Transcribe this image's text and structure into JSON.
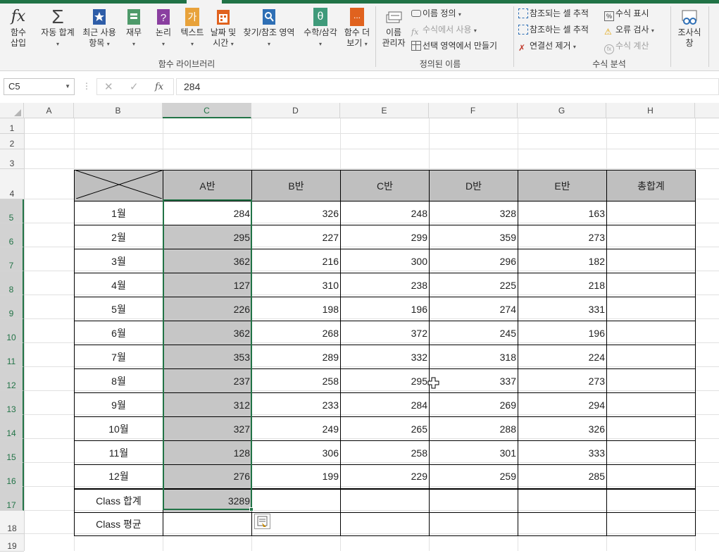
{
  "ribbon": {
    "groups": {
      "library": "함수 라이브러리",
      "names": "정의된 이름",
      "audit": "수식 분석"
    },
    "insert_fn": [
      "함수",
      "삽입"
    ],
    "autosum": [
      "자동 합계"
    ],
    "recent": [
      "최근 사용",
      "항목"
    ],
    "financial": [
      "재무"
    ],
    "logical": [
      "논리"
    ],
    "text": [
      "텍스트"
    ],
    "datetime": [
      "날짜 및",
      "시간"
    ],
    "lookup": [
      "찾기/참조 영역"
    ],
    "math": [
      "수학/삼각"
    ],
    "more": [
      "함수 더",
      "보기"
    ],
    "name_manager": [
      "이름",
      "관리자"
    ],
    "define_name": "이름 정의",
    "use_in_formula": "수식에서 사용",
    "create_from_sel": "선택 영역에서 만들기",
    "trace_precedents": "참조되는 셀 추적",
    "trace_dependents": "참조하는 셀 추적",
    "remove_arrows": "연결선 제거",
    "show_formulas": "수식 표시",
    "error_check": "오류 검사",
    "eval_formula": "수식 계산",
    "watch": [
      "조사식",
      "창"
    ],
    "text_icon": "가",
    "math_icon": "θ",
    "more_icon": "...",
    "fx_icon": "fx",
    "sigma_icon": "Σ"
  },
  "formula_bar": {
    "name_box": "C5",
    "value": "284"
  },
  "columns": [
    "A",
    "B",
    "C",
    "D",
    "E",
    "F",
    "G",
    "H"
  ],
  "rows": [
    "1",
    "2",
    "3",
    "4",
    "5",
    "6",
    "7",
    "8",
    "9",
    "10",
    "11",
    "12",
    "13",
    "14",
    "15",
    "16",
    "17",
    "18",
    "19"
  ],
  "table": {
    "headers": [
      "A반",
      "B반",
      "C반",
      "D반",
      "E반",
      "총합계"
    ],
    "months": [
      "1월",
      "2월",
      "3월",
      "4월",
      "5월",
      "6월",
      "7월",
      "8월",
      "9월",
      "10월",
      "11월",
      "12월"
    ],
    "values": [
      [
        284,
        326,
        248,
        328,
        163
      ],
      [
        295,
        227,
        299,
        359,
        273
      ],
      [
        362,
        216,
        300,
        296,
        182
      ],
      [
        127,
        310,
        238,
        225,
        218
      ],
      [
        226,
        198,
        196,
        274,
        331
      ],
      [
        362,
        268,
        372,
        245,
        196
      ],
      [
        353,
        289,
        332,
        318,
        224
      ],
      [
        237,
        258,
        295,
        337,
        273
      ],
      [
        312,
        233,
        284,
        269,
        294
      ],
      [
        327,
        249,
        265,
        288,
        326
      ],
      [
        128,
        306,
        258,
        301,
        333
      ],
      [
        276,
        199,
        229,
        259,
        285
      ]
    ],
    "sum_label": "Class 합계",
    "sum_value": "3289",
    "avg_label": "Class 평균"
  },
  "colors": {
    "accent": "#217346",
    "header_fill": "#bfbfbf",
    "selection_fill": "#c6c6c6"
  }
}
